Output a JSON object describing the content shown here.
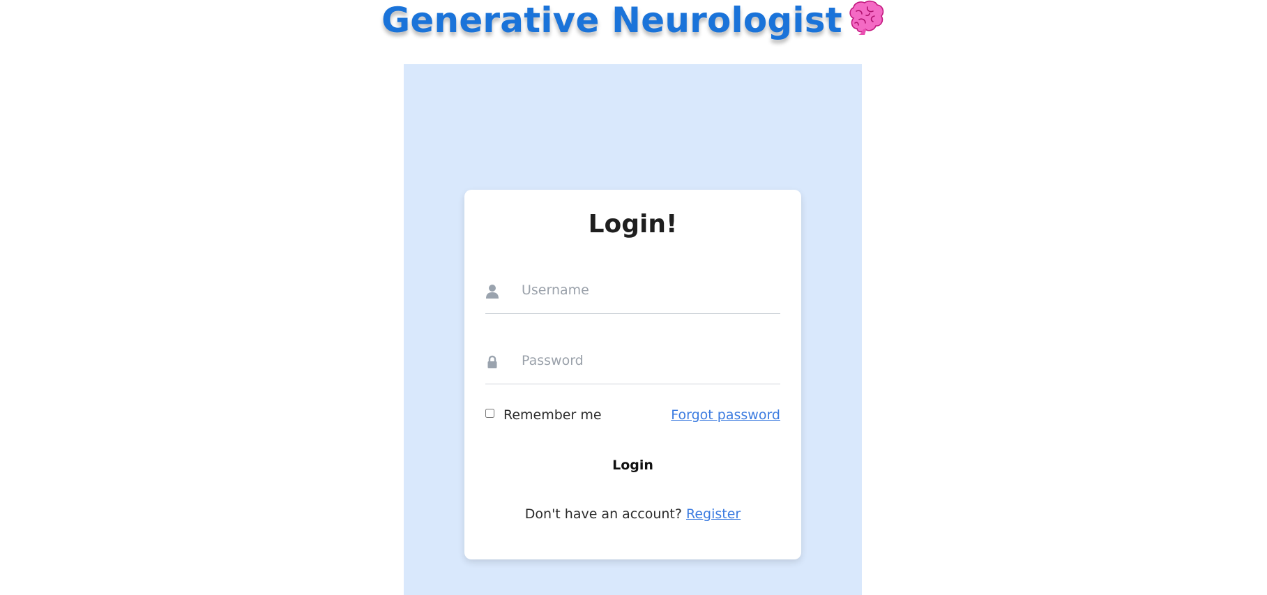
{
  "header": {
    "title": "Generative Neurologist",
    "icon": "brain-icon"
  },
  "login_card": {
    "title": "Login!",
    "username": {
      "icon": "user-icon",
      "placeholder": "Username",
      "value": ""
    },
    "password": {
      "icon": "lock-icon",
      "placeholder": "Password",
      "value": ""
    },
    "remember_label": "Remember me",
    "forgot_link": "Forgot password",
    "login_button": "Login",
    "register_prompt": "Don't have an account?",
    "register_link": "Register"
  },
  "colors": {
    "title": "#1a73d9",
    "panel_background": "#d9e8fc",
    "link": "#3b7be0"
  }
}
